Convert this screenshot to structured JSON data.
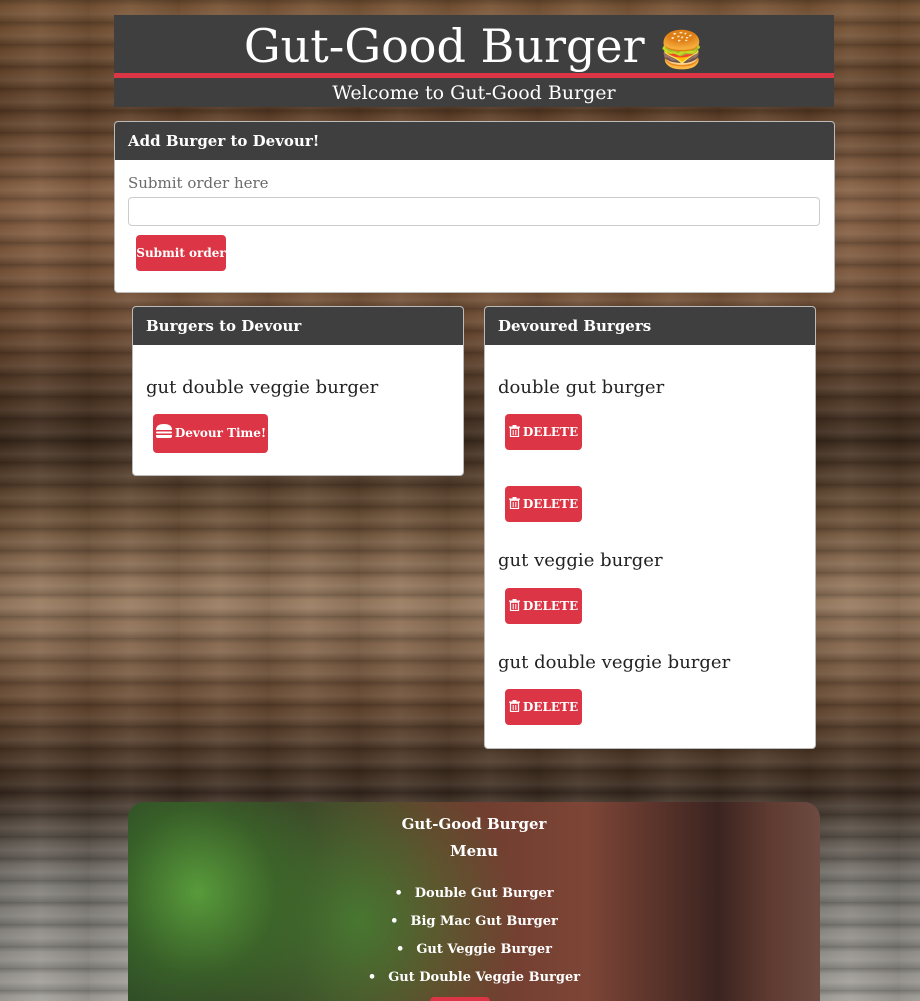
{
  "header": {
    "title": "Gut-Good Burger",
    "emoji": "🍔",
    "welcome": "Welcome to Gut-Good Burger"
  },
  "add_form": {
    "card_title": "Add Burger to Devour!",
    "label": "Submit order here",
    "input_value": "",
    "submit_label": "Submit order"
  },
  "to_devour": {
    "card_title": "Burgers to Devour",
    "items": [
      {
        "name": "gut double veggie burger",
        "button_label": "Devour Time!",
        "button_icon": "burger-icon"
      }
    ]
  },
  "devoured": {
    "card_title": "Devoured Burgers",
    "delete_label": "DELETE",
    "delete_icon": "trash-icon",
    "items": [
      {
        "name": "double gut burger"
      },
      {
        "name": ""
      },
      {
        "name": "gut veggie burger"
      },
      {
        "name": "gut double veggie burger"
      }
    ]
  },
  "footer": {
    "title": "Gut-Good Burger",
    "menu_heading": "Menu",
    "menu_items": [
      "Double Gut Burger",
      "Big Mac Gut Burger",
      "Gut Veggie Burger",
      "Gut Double Veggie Burger"
    ]
  },
  "colors": {
    "accent": "#dc3545",
    "header_bg": "#3f3f3f"
  }
}
